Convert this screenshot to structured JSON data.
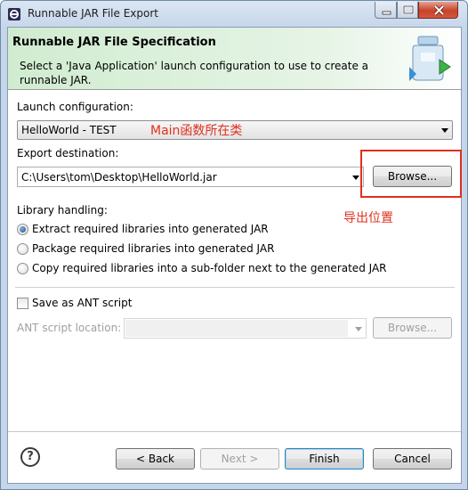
{
  "window": {
    "title": "Runnable JAR File Export",
    "controls": [
      "minimize-icon",
      "maximize-icon",
      "close-icon"
    ]
  },
  "header": {
    "title": "Runnable JAR File Specification",
    "description": "Select a 'Java Application' launch configuration to use to create a runnable JAR.",
    "icon": "jar-wizard-icon"
  },
  "launch": {
    "label": "Launch configuration:",
    "value": "HelloWorld - TEST"
  },
  "export": {
    "label": "Export destination:",
    "value": "C:\\Users\\tom\\Desktop\\HelloWorld.jar",
    "browse": "Browse..."
  },
  "library": {
    "label": "Library handling:",
    "options": [
      {
        "label": "Extract required libraries into generated JAR",
        "checked": true
      },
      {
        "label": "Package required libraries into generated JAR",
        "checked": false
      },
      {
        "label": "Copy required libraries into a sub-folder next to the generated JAR",
        "checked": false
      }
    ]
  },
  "ant": {
    "checkbox_label": "Save as ANT script",
    "checked": false,
    "location_label": "ANT script location:",
    "location_value": "",
    "browse": "Browse..."
  },
  "footer": {
    "help": "?",
    "back": "< Back",
    "next": "Next >",
    "finish": "Finish",
    "cancel": "Cancel"
  },
  "annotations": {
    "main_class": "Main函数所在类",
    "export_location": "导出位置",
    "color": "#e0301e"
  }
}
